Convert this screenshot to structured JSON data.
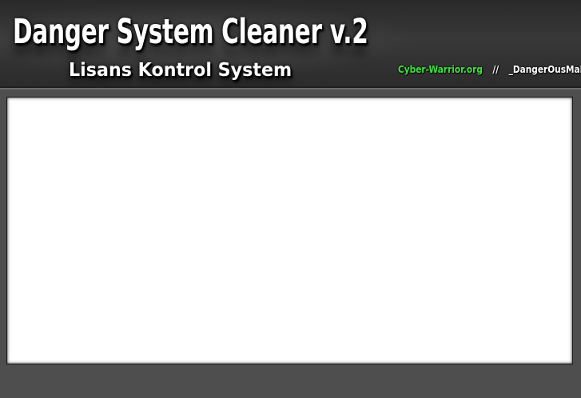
{
  "header": {
    "title": "Danger System Cleaner v.2",
    "subtitle": "Lisans Kontrol System"
  },
  "credits": {
    "site": "Cyber-Warrior.org",
    "separator": "//",
    "author": "_DangerOusMaN_"
  },
  "content": {
    "text": ""
  },
  "colors": {
    "background": "#4e4e4e",
    "header_background": "#333333",
    "panel_background": "#ffffff",
    "title_text": "#ffffff",
    "credit_site_text": "#39e639"
  }
}
